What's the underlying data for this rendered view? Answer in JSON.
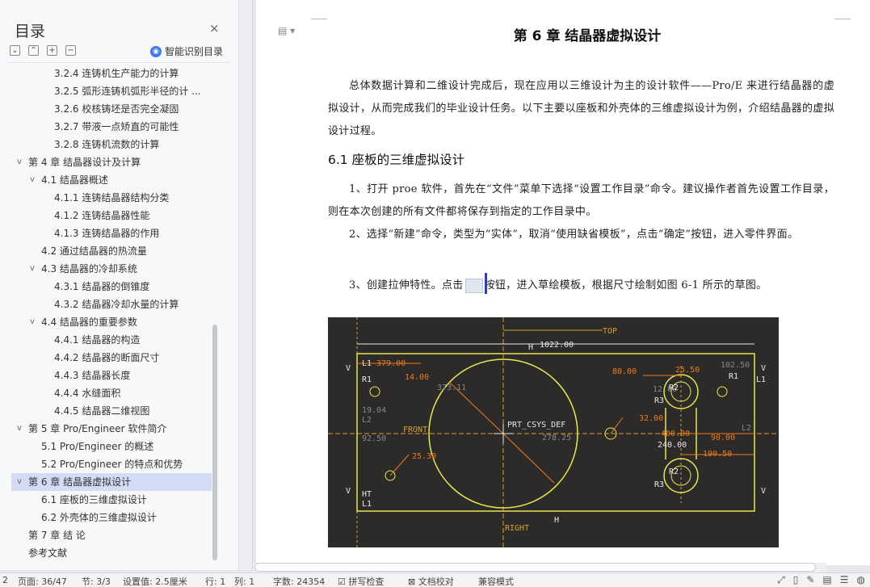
{
  "nav": {
    "title": "目录",
    "close": "×",
    "smart_toc": "智能识别目录",
    "tools": [
      "⌄",
      "⌃",
      "+",
      "−"
    ],
    "items": [
      {
        "label": "3.2.4  连铸机生产能力的计算",
        "level": 3,
        "chev": ""
      },
      {
        "label": "3.2.5  弧形连铸机弧形半径的计 ...",
        "level": 3,
        "chev": ""
      },
      {
        "label": "3.2.6  校核铸坯是否完全凝固",
        "level": 3,
        "chev": ""
      },
      {
        "label": "3.2.7  带液一点矫直的可能性",
        "level": 3,
        "chev": ""
      },
      {
        "label": "3.2.8  连铸机流数的计算",
        "level": 3,
        "chev": ""
      },
      {
        "label": "第 4 章   结晶器设计及计算",
        "level": 1,
        "chev": "v"
      },
      {
        "label": "4.1    结晶器概述",
        "level": 2,
        "chev": "v"
      },
      {
        "label": "4.1.1  连铸结晶器结构分类",
        "level": 3,
        "chev": ""
      },
      {
        "label": "4.1.2  连铸结晶器性能",
        "level": 3,
        "chev": ""
      },
      {
        "label": "4.1.3  连铸结晶器的作用",
        "level": 3,
        "chev": ""
      },
      {
        "label": "4.2    通过结晶器的热流量",
        "level": 2,
        "chev": ""
      },
      {
        "label": "4.3    结晶器的冷却系统",
        "level": 2,
        "chev": "v"
      },
      {
        "label": "4.3.1  结晶器的倒锥度",
        "level": 3,
        "chev": ""
      },
      {
        "label": "4.3.2  结晶器冷却水量的计算",
        "level": 3,
        "chev": ""
      },
      {
        "label": "4.4    结晶器的重要参数",
        "level": 2,
        "chev": "v"
      },
      {
        "label": "4.4.1  结晶器的构造",
        "level": 3,
        "chev": ""
      },
      {
        "label": "4.4.2  结晶器的断面尺寸",
        "level": 3,
        "chev": ""
      },
      {
        "label": "4.4.3  结晶器长度",
        "level": 3,
        "chev": ""
      },
      {
        "label": "4.4.4  水缝面积",
        "level": 3,
        "chev": ""
      },
      {
        "label": "4.4.5  结晶器二维视图",
        "level": 3,
        "chev": ""
      },
      {
        "label": "第 5 章  Pro/Engineer 软件简介",
        "level": 1,
        "chev": "v"
      },
      {
        "label": "5.1 Pro/Engineer 的概述",
        "level": 2,
        "chev": ""
      },
      {
        "label": "5.2 Pro/Engineer 的特点和优势",
        "level": 2,
        "chev": ""
      },
      {
        "label": "第 6 章   结晶器虚拟设计",
        "level": 1,
        "chev": "v",
        "active": true
      },
      {
        "label": "6.1 座板的三维虚拟设计",
        "level": 2,
        "chev": ""
      },
      {
        "label": "6.2 外壳体的三维虚拟设计",
        "level": 2,
        "chev": ""
      },
      {
        "label": "第 7 章    结    论",
        "level": 1,
        "chev": ""
      },
      {
        "label": "参考文献",
        "level": 1,
        "chev": ""
      }
    ]
  },
  "document": {
    "chapter_title": "第 6 章    结晶器虚拟设计",
    "doc_icon": "▤ ▾",
    "intro": "总体数据计算和二维设计完成后，现在应用以三维设计为主的设计软件——Pro/E 来进行结晶器的虚拟设计，从而完成我们的毕业设计任务。以下主要以座板和外壳体的三维虚拟设计为例，介绍结晶器的虚拟设计过程。",
    "section_heading": "6.1 座板的三维虚拟设计",
    "step1": "1、打开 proe 软件，首先在“文件”菜单下选择“设置工作目录”命令。建议操作者首先设置工作目录，则在本次创建的所有文件都将保存到指定的工作目录中。",
    "step2": "2、选择“新建”命令，类型为“实体”，取消“使用缺省模板”，点击“确定”按钮，进入零件界面。",
    "step3_a": "3、创建拉伸特性。点击",
    "step3_b": "按钮，进入草绘模板，根据尺寸绘制如图 6-1 所示的草图。"
  },
  "figure": {
    "labels": {
      "top": "TOP",
      "front": "FRONT",
      "right": "RIGHT",
      "csys": "PRT_CSYS_DEF",
      "d1022": "1022.00",
      "d379": "379.00",
      "d14": "14.00",
      "d373": "373.11",
      "d80": "80.00",
      "d25_5": "25.50",
      "d12": "12.00",
      "d102_5": "102.50",
      "d32": "32.00",
      "d400": "400.00",
      "d90": "90.00",
      "d240": "240.00",
      "d190": "190.50",
      "d25_3": "25.30",
      "d278": "278.25",
      "d92": "92.50",
      "d19": "19.04",
      "h": "H",
      "v": "V",
      "l1": "L1",
      "l2": "L2",
      "r1": "R1",
      "r2": "R2",
      "r3": "R3",
      "ht": "HT"
    },
    "colors": {
      "background": "#2c2b2a",
      "geometry": "#e8e84a",
      "dimension": "#f07a1a",
      "datum": "#d4a030",
      "constraint": "#e8e8e8"
    }
  },
  "status": {
    "page_no": "2",
    "page": "页面: 36/47",
    "section": "节: 3/3",
    "setting": "设置值: 2.5厘米",
    "row": "行: 1",
    "col": "列: 1",
    "words": "字数: 24354",
    "spell": "☑ 拼写检查",
    "proof": "⊠ 文档校对",
    "compat": "兼容模式"
  }
}
